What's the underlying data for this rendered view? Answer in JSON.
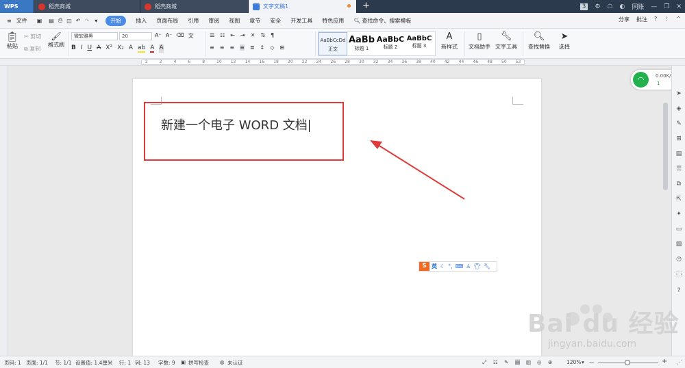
{
  "tabs": {
    "wps": "WPS",
    "t1": "稻壳商城",
    "t2": "稻壳商城",
    "t3": "文字文稿1",
    "plus": "+",
    "num": "3",
    "user": "同账"
  },
  "menu": {
    "file": "文件",
    "items": [
      "开始",
      "插入",
      "页面布局",
      "引用",
      "审阅",
      "视图",
      "章节",
      "安全",
      "开发工具",
      "特色应用"
    ],
    "search": "查找命令、搜索模板",
    "share": "分享",
    "comment": "批注"
  },
  "ribbon": {
    "paste": "粘贴",
    "cut": "剪切",
    "copy": "复制",
    "format_painter": "格式刷",
    "font_name": "微软雅黑",
    "font_size": "20",
    "styles": [
      {
        "preview": "AaBbCcDd",
        "name": "正文"
      },
      {
        "preview": "AaBb",
        "name": "标题 1"
      },
      {
        "preview": "AaBbC",
        "name": "标题 2"
      },
      {
        "preview": "AaBbC",
        "name": "标题 3"
      }
    ],
    "new_style": "新样式",
    "doc_helper": "文档助手",
    "doc_tools": "文字工具",
    "find_replace": "查找替换",
    "select": "选择"
  },
  "ruler_ticks": [
    "2",
    "2",
    "4",
    "6",
    "8",
    "10",
    "12",
    "14",
    "16",
    "18",
    "20",
    "22",
    "24",
    "26",
    "28",
    "30",
    "32",
    "34",
    "36",
    "38",
    "40",
    "42",
    "44",
    "46",
    "48",
    "50",
    "52"
  ],
  "document": {
    "text": "新建一个电子 WORD 文档"
  },
  "ime": {
    "logo": "S",
    "lang": "英"
  },
  "network": {
    "speed": "0.00K/s",
    "count": "1"
  },
  "status": {
    "page_num": "页码: 1",
    "page": "页面: 1/1",
    "section": "节: 1/1",
    "setting": "设置值: 1.4厘米",
    "row": "行: 1",
    "col": "列: 13",
    "words": "字数: 9",
    "spell": "拼写检查",
    "cert": "未认证",
    "zoom": "120%"
  },
  "watermark": {
    "brand": "Bai du 经验",
    "url": "jingyan.baidu.com"
  },
  "colors": {
    "accent": "#4a8be8",
    "annotation": "#e03b3b",
    "tabbar": "#2c3a4d"
  }
}
